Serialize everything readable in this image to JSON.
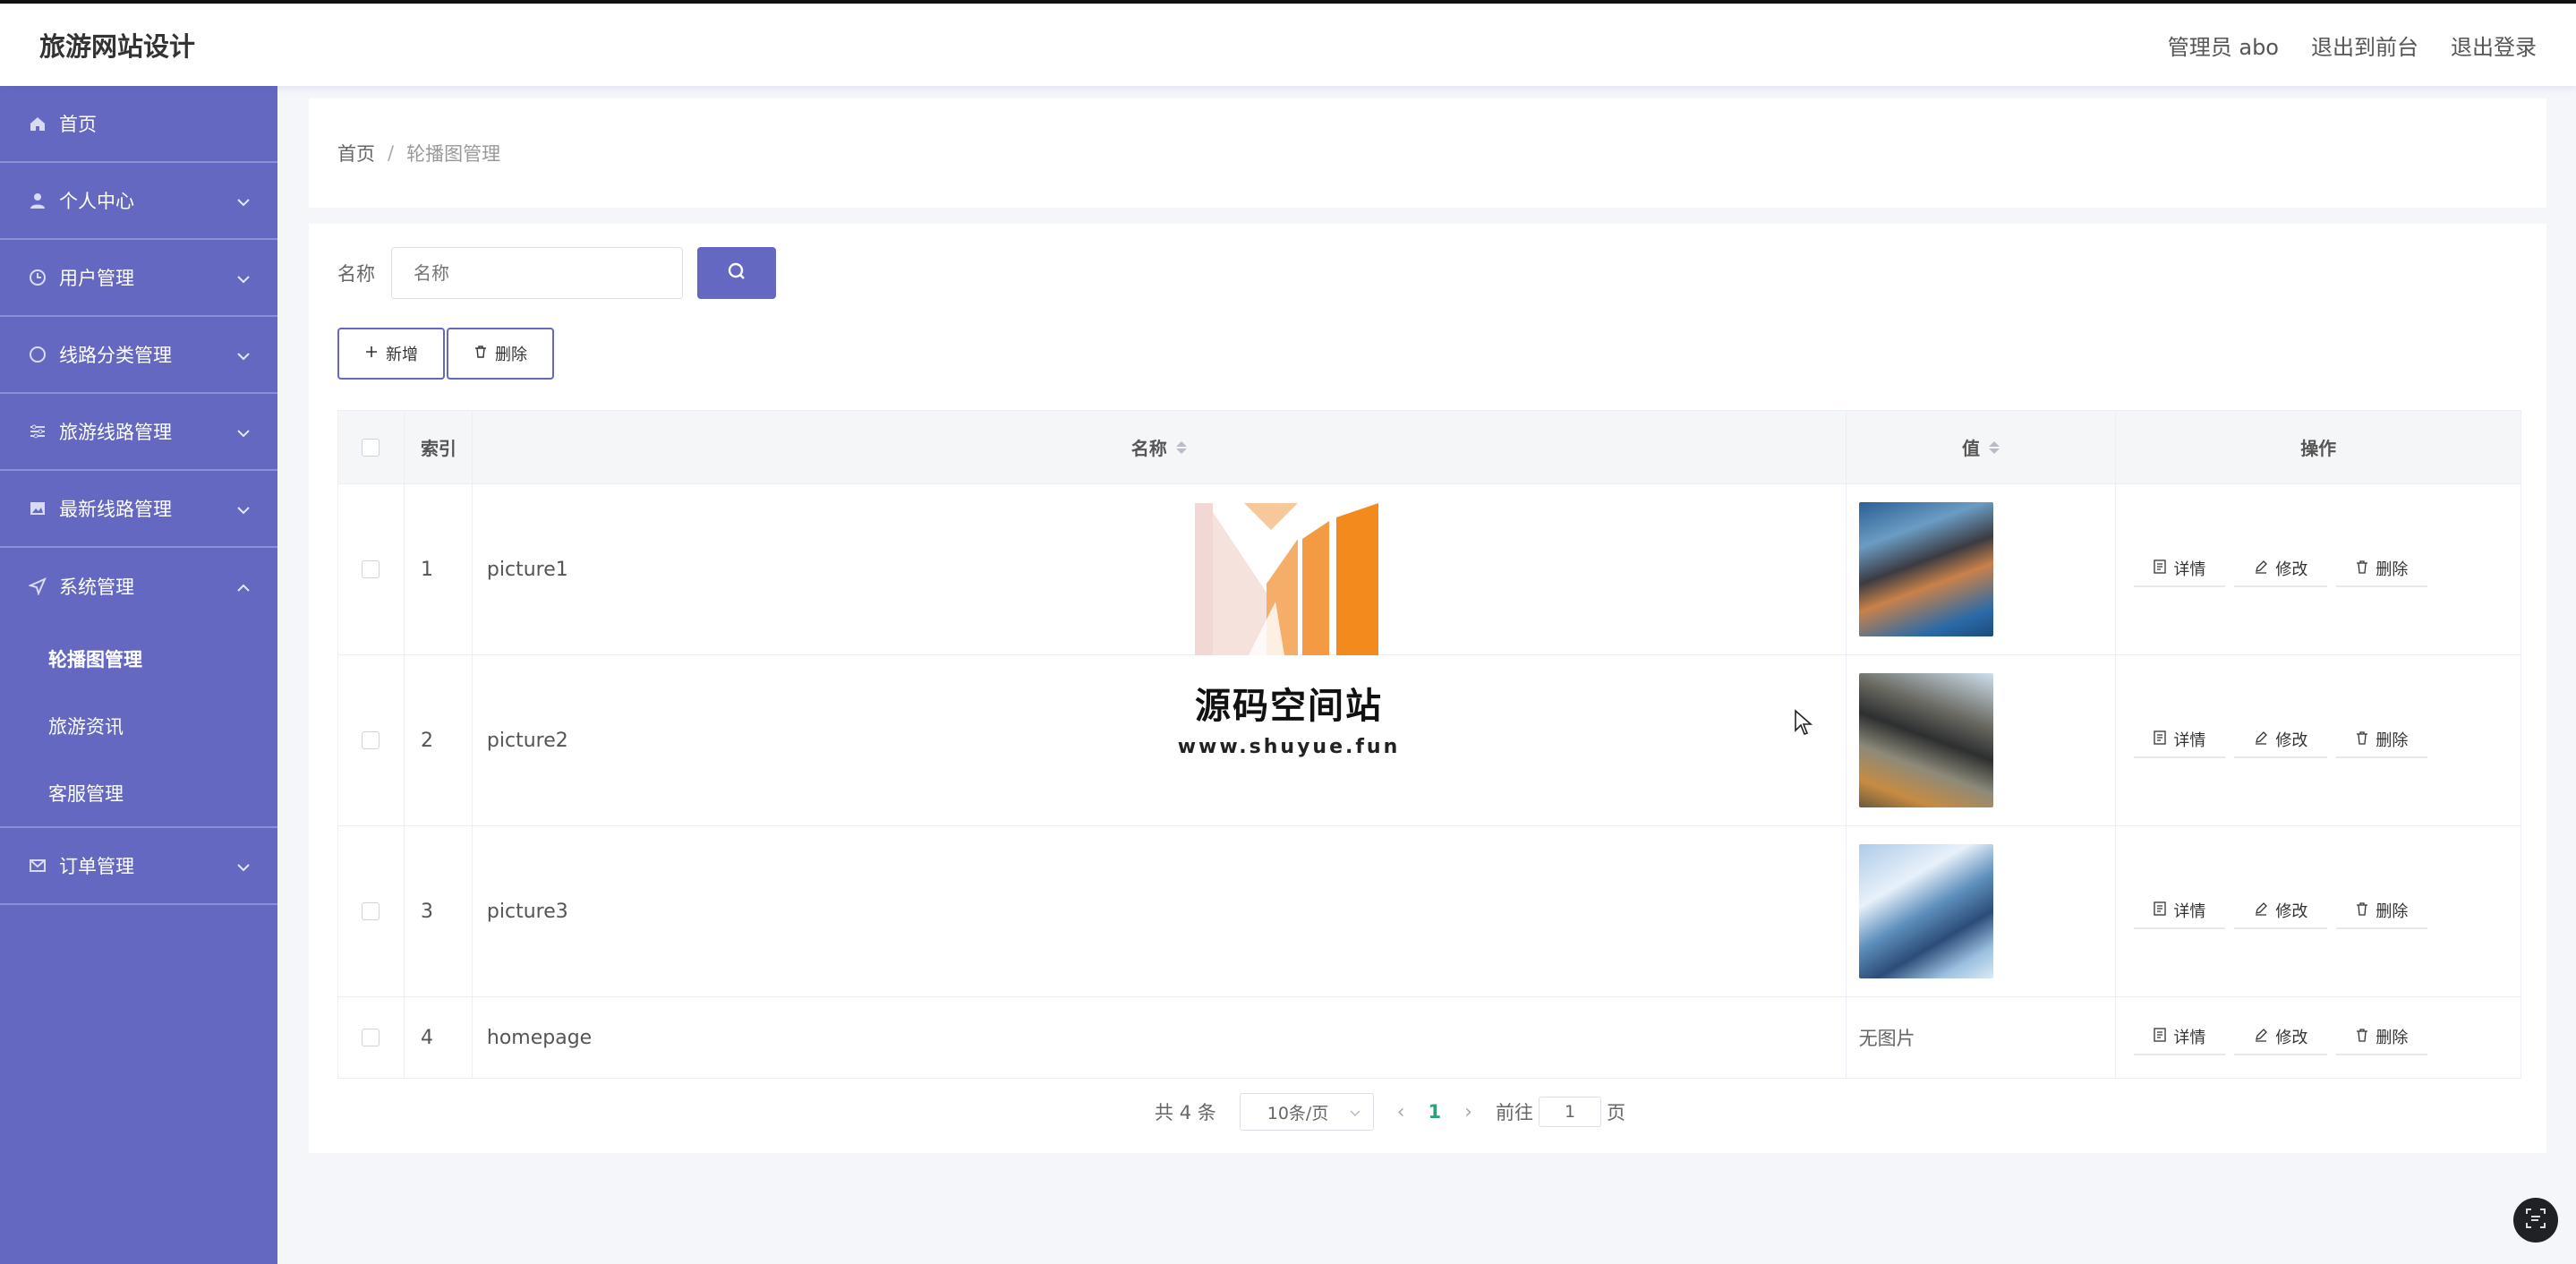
{
  "header": {
    "brand": "旅游网站设计",
    "admin": "管理员 abo",
    "to_front": "退出到前台",
    "logout": "退出登录"
  },
  "sidebar": {
    "items": [
      {
        "label": "首页",
        "icon": "home-icon"
      },
      {
        "label": "个人中心",
        "icon": "user-icon"
      },
      {
        "label": "用户管理",
        "icon": "clock-icon"
      },
      {
        "label": "线路分类管理",
        "icon": "compass-icon"
      },
      {
        "label": "旅游线路管理",
        "icon": "sliders-icon"
      },
      {
        "label": "最新线路管理",
        "icon": "image-icon"
      },
      {
        "label": "系统管理",
        "icon": "send-icon"
      },
      {
        "label": "订单管理",
        "icon": "mail-icon"
      }
    ],
    "sub_items": [
      "轮播图管理",
      "旅游资讯",
      "客服管理"
    ]
  },
  "breadcrumb": {
    "home": "首页",
    "sep": "/",
    "current": "轮播图管理"
  },
  "search": {
    "label": "名称",
    "placeholder": "名称"
  },
  "actions": {
    "add": "新增",
    "delete": "删除"
  },
  "table": {
    "headers": {
      "index": "索引",
      "name": "名称",
      "value": "值",
      "ops": "操作"
    },
    "rows": [
      {
        "index": "1",
        "name": "picture1",
        "value": "",
        "has_image": true
      },
      {
        "index": "2",
        "name": "picture2",
        "value": "",
        "has_image": true
      },
      {
        "index": "3",
        "name": "picture3",
        "value": "",
        "has_image": true
      },
      {
        "index": "4",
        "name": "homepage",
        "value": "无图片",
        "has_image": false
      }
    ],
    "op_labels": {
      "detail": "详情",
      "edit": "修改",
      "delete": "删除"
    }
  },
  "pagination": {
    "total": "共 4 条",
    "page_size": "10条/页",
    "current_page": "1",
    "goto_label": "前往",
    "goto_value": "1",
    "page_unit": "页"
  },
  "watermark": {
    "title": "源码空间站",
    "url": "www.shuyue.fun"
  },
  "colors": {
    "accent": "#6468c1",
    "sidebar_divider": "#8c90d6",
    "current_page": "#2f9e7b"
  }
}
